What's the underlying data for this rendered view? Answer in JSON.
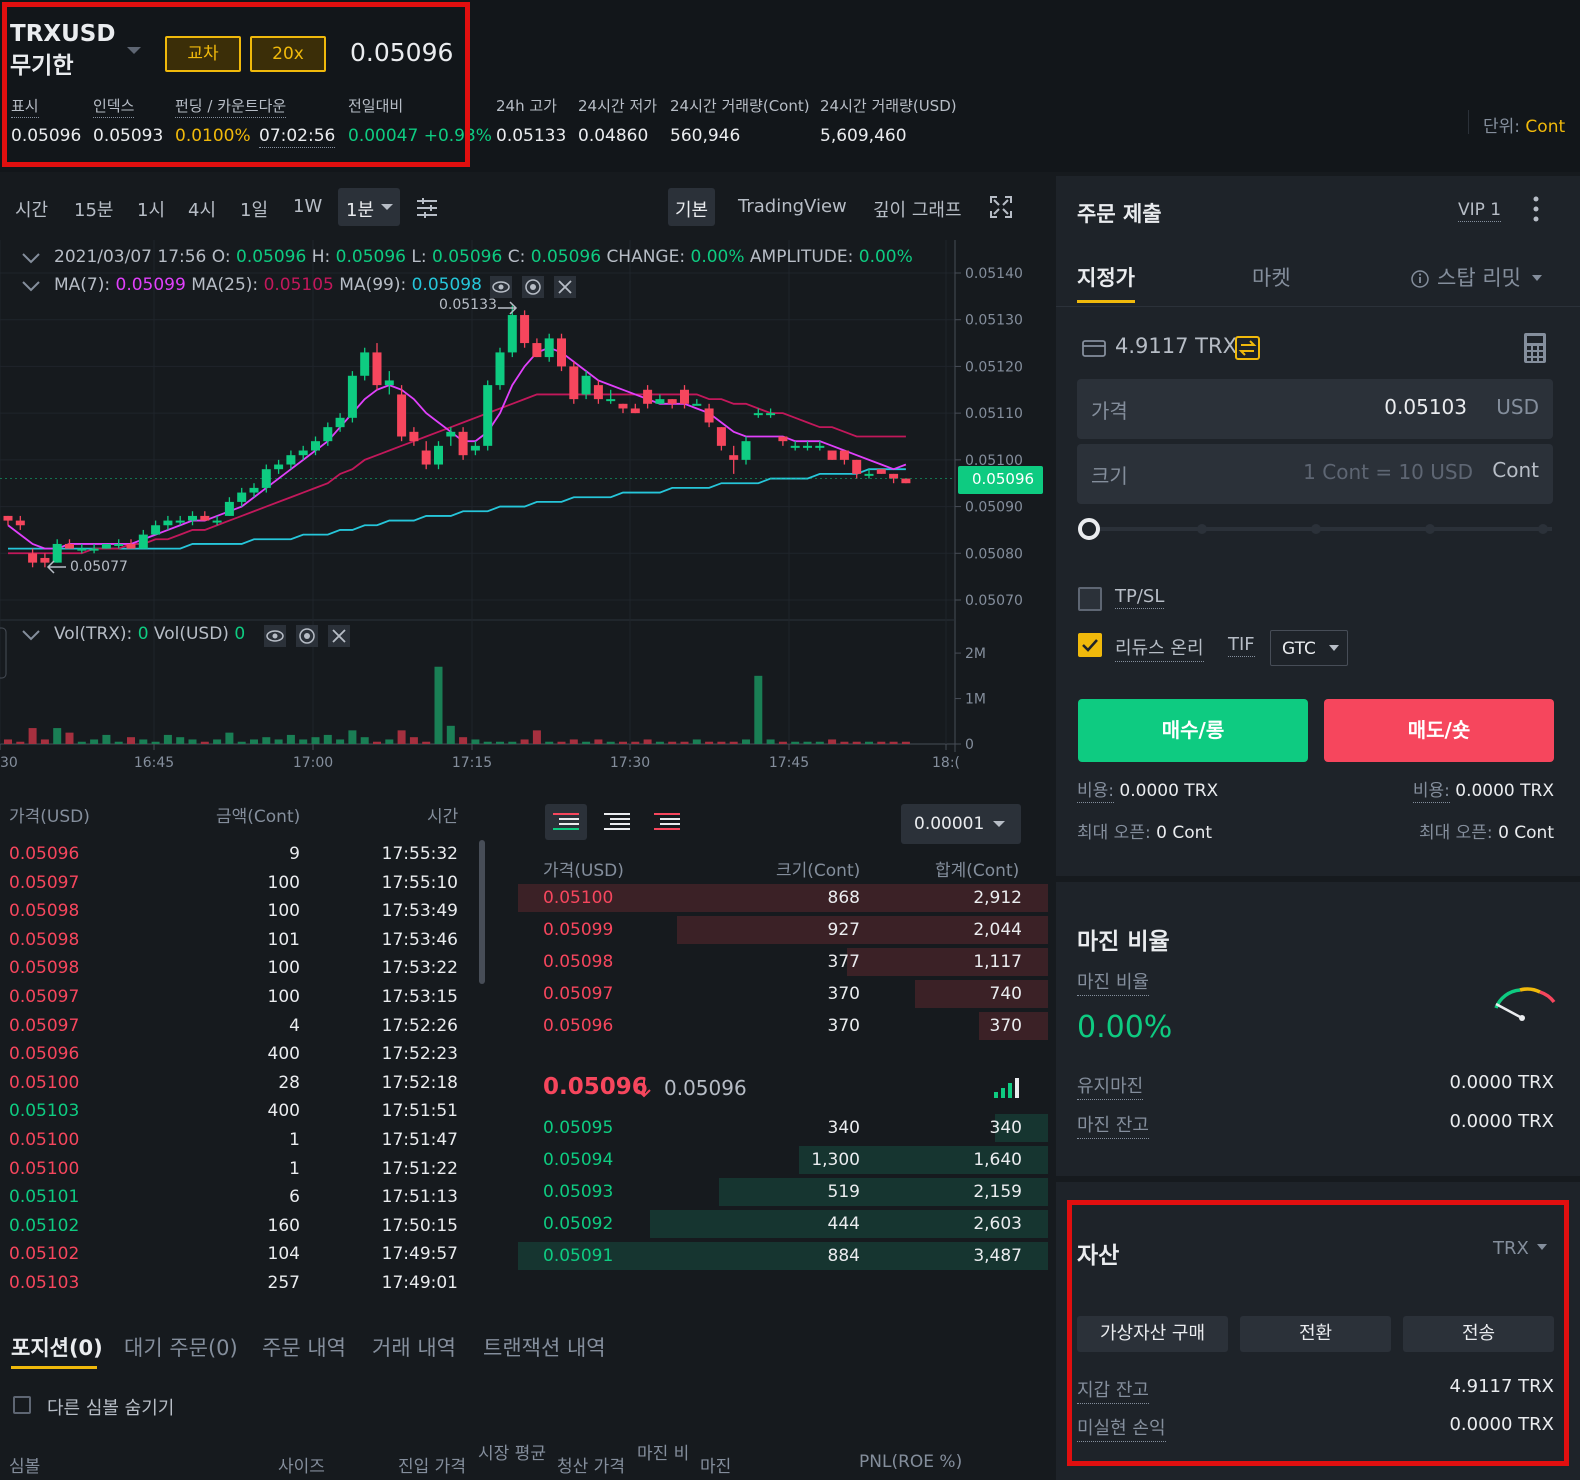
{
  "header": {
    "symbol": "TRXUSD",
    "symbol_sub": "무기한",
    "cross_label": "교차",
    "leverage_label": "20x",
    "last_price": "0.05096",
    "stats": [
      {
        "label": "표시",
        "value": "0.05096"
      },
      {
        "label": "인덱스",
        "value": "0.05093"
      },
      {
        "label": "펀딩 / 카운트다운",
        "value": "0.0100%",
        "value2": "07:02:56"
      },
      {
        "label": "전일대비",
        "value": "0.00047 +0.93%"
      },
      {
        "label": "24h 고가",
        "value": "0.05133"
      },
      {
        "label": "24시간 저가",
        "value": "0.04860"
      },
      {
        "label": "24시간 거래량(Cont)",
        "value": "560,946"
      },
      {
        "label": "24시간 거래량(USD)",
        "value": "5,609,460"
      }
    ],
    "unit_label": "단위:",
    "unit_value": "Cont"
  },
  "chart_toolbar": {
    "intervals": [
      "시간",
      "15분",
      "1시",
      "4시",
      "1일",
      "1W"
    ],
    "selected_interval": "1분",
    "views": [
      "기본",
      "TradingView",
      "깊이 그래프"
    ]
  },
  "chart_info": {
    "line1": {
      "date": "2021/03/07 17:56",
      "o": "0.05096",
      "h": "0.05096",
      "l": "0.05096",
      "c": "0.05096",
      "change": "0.00%",
      "amplitude": "0.00%"
    },
    "line2": {
      "ma7": "0.05099",
      "ma25": "0.05105",
      "ma99": "0.05098"
    },
    "vol": {
      "trx": "0",
      "usd": "0"
    },
    "high_marker": "0.05133",
    "low_marker": "0.05077",
    "current_tag": "0.05096",
    "colors": {
      "up": "#0ecb81",
      "down": "#f6465d",
      "ma7": "#e040fb",
      "ma25": "#c2185b",
      "ma99": "#26c6da"
    }
  },
  "chart_data": {
    "type": "candlestick",
    "y_ticks": [
      "0.05140",
      "0.05130",
      "0.05120",
      "0.05110",
      "0.05100",
      "0.05090",
      "0.05080",
      "0.05070"
    ],
    "ylim": [
      0.0507,
      0.0514
    ],
    "x_ticks": [
      "30",
      "16:45",
      "17:00",
      "17:15",
      "17:30",
      "17:45",
      "18:("
    ],
    "vol_ticks": [
      "2M",
      "1M",
      "0"
    ],
    "candles": [
      [
        0.05088,
        0.05088,
        0.05086,
        0.05087
      ],
      [
        0.05087,
        0.05088,
        0.05085,
        0.05086
      ],
      [
        0.0508,
        0.05081,
        0.05077,
        0.05078
      ],
      [
        0.05079,
        0.0508,
        0.05077,
        0.05078
      ],
      [
        0.05078,
        0.05083,
        0.05078,
        0.05082
      ],
      [
        0.05082,
        0.05083,
        0.05081,
        0.05081
      ],
      [
        0.05081,
        0.05082,
        0.0508,
        0.05081
      ],
      [
        0.05081,
        0.05082,
        0.0508,
        0.05081
      ],
      [
        0.05081,
        0.05082,
        0.05081,
        0.05082
      ],
      [
        0.05082,
        0.05083,
        0.05081,
        0.05082
      ],
      [
        0.05082,
        0.05083,
        0.05081,
        0.05081
      ],
      [
        0.05081,
        0.05085,
        0.05081,
        0.05084
      ],
      [
        0.05084,
        0.05087,
        0.05084,
        0.05086
      ],
      [
        0.05086,
        0.05088,
        0.05085,
        0.05087
      ],
      [
        0.05087,
        0.05088,
        0.05086,
        0.05087
      ],
      [
        0.05087,
        0.05089,
        0.05086,
        0.05088
      ],
      [
        0.05088,
        0.05089,
        0.05087,
        0.05087
      ],
      [
        0.05087,
        0.05088,
        0.05086,
        0.05087
      ],
      [
        0.05088,
        0.05092,
        0.05088,
        0.05091
      ],
      [
        0.05091,
        0.05094,
        0.0509,
        0.05093
      ],
      [
        0.05093,
        0.05095,
        0.05092,
        0.05094
      ],
      [
        0.05094,
        0.05099,
        0.05093,
        0.05098
      ],
      [
        0.05098,
        0.051,
        0.05097,
        0.05099
      ],
      [
        0.05099,
        0.05102,
        0.05098,
        0.05101
      ],
      [
        0.05101,
        0.05103,
        0.051,
        0.05102
      ],
      [
        0.05102,
        0.05105,
        0.05101,
        0.05104
      ],
      [
        0.05104,
        0.05108,
        0.05103,
        0.05107
      ],
      [
        0.05107,
        0.0511,
        0.05106,
        0.05109
      ],
      [
        0.05109,
        0.05119,
        0.05108,
        0.05118
      ],
      [
        0.05118,
        0.05124,
        0.05117,
        0.05123
      ],
      [
        0.05123,
        0.05125,
        0.05115,
        0.05116
      ],
      [
        0.05116,
        0.05119,
        0.05114,
        0.05117
      ],
      [
        0.05114,
        0.05116,
        0.05104,
        0.05105
      ],
      [
        0.05106,
        0.05107,
        0.05103,
        0.05104
      ],
      [
        0.05102,
        0.05104,
        0.05098,
        0.05099
      ],
      [
        0.05099,
        0.05104,
        0.05098,
        0.05103
      ],
      [
        0.05105,
        0.05107,
        0.05103,
        0.05106
      ],
      [
        0.05106,
        0.05107,
        0.051,
        0.05101
      ],
      [
        0.05102,
        0.05104,
        0.05101,
        0.05103
      ],
      [
        0.05103,
        0.05117,
        0.05102,
        0.05116
      ],
      [
        0.05116,
        0.05124,
        0.05115,
        0.05123
      ],
      [
        0.05123,
        0.05133,
        0.05122,
        0.05131
      ],
      [
        0.05131,
        0.05132,
        0.05124,
        0.05125
      ],
      [
        0.05125,
        0.05126,
        0.05122,
        0.05122
      ],
      [
        0.05122,
        0.05127,
        0.05121,
        0.05126
      ],
      [
        0.05126,
        0.05127,
        0.05119,
        0.0512
      ],
      [
        0.0512,
        0.05121,
        0.05112,
        0.05113
      ],
      [
        0.05114,
        0.05119,
        0.05113,
        0.05118
      ],
      [
        0.05116,
        0.05117,
        0.05112,
        0.05113
      ],
      [
        0.05113,
        0.05115,
        0.05112,
        0.05113
      ],
      [
        0.05112,
        0.05112,
        0.0511,
        0.05111
      ],
      [
        0.05111,
        0.05112,
        0.0511,
        0.0511
      ],
      [
        0.05115,
        0.05116,
        0.05111,
        0.05112
      ],
      [
        0.05112,
        0.05114,
        0.05112,
        0.05113
      ],
      [
        0.05113,
        0.05113,
        0.05111,
        0.05112
      ],
      [
        0.05115,
        0.05116,
        0.05111,
        0.05112
      ],
      [
        0.05112,
        0.05113,
        0.05112,
        0.05112
      ],
      [
        0.05111,
        0.05112,
        0.05107,
        0.05108
      ],
      [
        0.05107,
        0.05107,
        0.05102,
        0.05103
      ],
      [
        0.05101,
        0.05103,
        0.05097,
        0.051
      ],
      [
        0.051,
        0.05105,
        0.05099,
        0.05104
      ],
      [
        0.0511,
        0.05111,
        0.05109,
        0.0511
      ],
      [
        0.0511,
        0.05111,
        0.05109,
        0.0511
      ],
      [
        0.05105,
        0.05105,
        0.05103,
        0.05104
      ],
      [
        0.05103,
        0.05104,
        0.05102,
        0.05103
      ],
      [
        0.05103,
        0.05104,
        0.05102,
        0.05103
      ],
      [
        0.05103,
        0.05104,
        0.05102,
        0.05103
      ],
      [
        0.05102,
        0.05102,
        0.051,
        0.051
      ],
      [
        0.05102,
        0.05102,
        0.05099,
        0.051
      ],
      [
        0.051,
        0.051,
        0.05096,
        0.05097
      ],
      [
        0.05097,
        0.05098,
        0.05096,
        0.05097
      ],
      [
        0.05098,
        0.05098,
        0.05097,
        0.05097
      ],
      [
        0.05097,
        0.05097,
        0.05095,
        0.05096
      ],
      [
        0.05096,
        0.05096,
        0.05095,
        0.05095
      ]
    ],
    "volumes": [
      0.1,
      0.05,
      0.35,
      0.1,
      0.35,
      0.25,
      0.05,
      0.1,
      0.2,
      0.05,
      0.15,
      0.1,
      0.05,
      0.2,
      0.15,
      0.1,
      0.05,
      0.1,
      0.25,
      0.05,
      0.1,
      0.15,
      0.1,
      0.2,
      0.1,
      0.15,
      0.2,
      0.1,
      0.3,
      0.15,
      0.05,
      0.1,
      0.3,
      0.15,
      0.05,
      1.7,
      0.4,
      0.15,
      0.1,
      0.05,
      0.05,
      0.05,
      0.1,
      0.3,
      0.05,
      0.05,
      0.1,
      0.05,
      0.1,
      0.05,
      0.05,
      0.05,
      0.1,
      0.05,
      0.05,
      0.05,
      0.1,
      0.05,
      0.05,
      0.05,
      0.1,
      1.5,
      0.1,
      0.05,
      0.05,
      0.05,
      0.05,
      0.1,
      0.05,
      0.05,
      0.05,
      0.05,
      0.05,
      0.05
    ],
    "ma7": [
      0.05086,
      0.05084,
      0.05082,
      0.05081,
      0.05081,
      0.05082,
      0.05082,
      0.05082,
      0.05082,
      0.05082,
      0.05082,
      0.05083,
      0.05084,
      0.05085,
      0.05086,
      0.05087,
      0.05087,
      0.05088,
      0.05089,
      0.0509,
      0.05092,
      0.05094,
      0.05096,
      0.05098,
      0.051,
      0.05102,
      0.05104,
      0.05107,
      0.0511,
      0.05113,
      0.05115,
      0.05116,
      0.05115,
      0.05113,
      0.0511,
      0.05108,
      0.05106,
      0.05104,
      0.05104,
      0.05106,
      0.0511,
      0.05116,
      0.0512,
      0.05123,
      0.05124,
      0.05123,
      0.05121,
      0.05119,
      0.05117,
      0.05116,
      0.05115,
      0.05114,
      0.05113,
      0.05112,
      0.05112,
      0.05112,
      0.05111,
      0.0511,
      0.05108,
      0.05106,
      0.05105,
      0.05105,
      0.05105,
      0.05105,
      0.05104,
      0.05104,
      0.05104,
      0.05103,
      0.05102,
      0.05101,
      0.051,
      0.05099,
      0.05098,
      0.05099
    ],
    "ma25": [
      0.0508,
      0.0508,
      0.0508,
      0.0508,
      0.0508,
      0.0508,
      0.0508,
      0.05081,
      0.05081,
      0.05081,
      0.05082,
      0.05082,
      0.05083,
      0.05083,
      0.05084,
      0.05085,
      0.05085,
      0.05086,
      0.05087,
      0.05088,
      0.05089,
      0.0509,
      0.05091,
      0.05092,
      0.05093,
      0.05094,
      0.05095,
      0.05097,
      0.05098,
      0.051,
      0.05101,
      0.05102,
      0.05103,
      0.05104,
      0.05105,
      0.05106,
      0.05107,
      0.05108,
      0.05109,
      0.0511,
      0.05111,
      0.05112,
      0.05113,
      0.05114,
      0.05114,
      0.05114,
      0.05114,
      0.05114,
      0.05114,
      0.05114,
      0.05114,
      0.05114,
      0.05114,
      0.05114,
      0.05114,
      0.05114,
      0.05114,
      0.05113,
      0.05113,
      0.05112,
      0.05112,
      0.05111,
      0.0511,
      0.0511,
      0.05109,
      0.05108,
      0.05107,
      0.05107,
      0.05106,
      0.05105,
      0.05105,
      0.05105,
      0.05105,
      0.05105
    ],
    "ma99": [
      0.05081,
      0.05081,
      0.05081,
      0.05081,
      0.05081,
      0.05081,
      0.05081,
      0.05081,
      0.05081,
      0.05081,
      0.05081,
      0.05081,
      0.05081,
      0.05081,
      0.05081,
      0.05082,
      0.05082,
      0.05082,
      0.05082,
      0.05082,
      0.05083,
      0.05083,
      0.05083,
      0.05083,
      0.05084,
      0.05084,
      0.05084,
      0.05085,
      0.05085,
      0.05086,
      0.05086,
      0.05087,
      0.05087,
      0.05087,
      0.05088,
      0.05088,
      0.05088,
      0.05089,
      0.05089,
      0.05089,
      0.0509,
      0.0509,
      0.0509,
      0.05091,
      0.05091,
      0.05091,
      0.05092,
      0.05092,
      0.05092,
      0.05092,
      0.05093,
      0.05093,
      0.05093,
      0.05093,
      0.05094,
      0.05094,
      0.05094,
      0.05094,
      0.05095,
      0.05095,
      0.05095,
      0.05095,
      0.05096,
      0.05096,
      0.05096,
      0.05096,
      0.05097,
      0.05097,
      0.05097,
      0.05097,
      0.05098,
      0.05098,
      0.05098,
      0.05098
    ]
  },
  "trades": {
    "headers": [
      "가격(USD)",
      "금액(Cont)",
      "시간"
    ],
    "rows": [
      {
        "price": "0.05096",
        "side": "dn",
        "amount": "9",
        "time": "17:55:32"
      },
      {
        "price": "0.05097",
        "side": "dn",
        "amount": "100",
        "time": "17:55:10"
      },
      {
        "price": "0.05098",
        "side": "dn",
        "amount": "100",
        "time": "17:53:49"
      },
      {
        "price": "0.05098",
        "side": "dn",
        "amount": "101",
        "time": "17:53:46"
      },
      {
        "price": "0.05098",
        "side": "dn",
        "amount": "100",
        "time": "17:53:22"
      },
      {
        "price": "0.05097",
        "side": "dn",
        "amount": "100",
        "time": "17:53:15"
      },
      {
        "price": "0.05097",
        "side": "dn",
        "amount": "4",
        "time": "17:52:26"
      },
      {
        "price": "0.05096",
        "side": "dn",
        "amount": "400",
        "time": "17:52:23"
      },
      {
        "price": "0.05100",
        "side": "dn",
        "amount": "28",
        "time": "17:52:18"
      },
      {
        "price": "0.05103",
        "side": "up",
        "amount": "400",
        "time": "17:51:51"
      },
      {
        "price": "0.05100",
        "side": "dn",
        "amount": "1",
        "time": "17:51:47"
      },
      {
        "price": "0.05100",
        "side": "dn",
        "amount": "1",
        "time": "17:51:22"
      },
      {
        "price": "0.05101",
        "side": "up",
        "amount": "6",
        "time": "17:51:13"
      },
      {
        "price": "0.05102",
        "side": "up",
        "amount": "160",
        "time": "17:50:15"
      },
      {
        "price": "0.05102",
        "side": "dn",
        "amount": "104",
        "time": "17:49:57"
      },
      {
        "price": "0.05103",
        "side": "dn",
        "amount": "257",
        "time": "17:49:01"
      }
    ]
  },
  "orderbook": {
    "precision": "0.00001",
    "headers": [
      "가격(USD)",
      "크기(Cont)",
      "합계(Cont)"
    ],
    "asks": [
      {
        "price": "0.05100",
        "size": "868",
        "total": "2,912",
        "depth": 1.0
      },
      {
        "price": "0.05099",
        "size": "927",
        "total": "2,044",
        "depth": 0.7
      },
      {
        "price": "0.05098",
        "size": "377",
        "total": "1,117",
        "depth": 0.38
      },
      {
        "price": "0.05097",
        "size": "370",
        "total": "740",
        "depth": 0.25
      },
      {
        "price": "0.05096",
        "size": "370",
        "total": "370",
        "depth": 0.13
      }
    ],
    "mid_price": "0.05096",
    "mid_mark": "0.05096",
    "bids": [
      {
        "price": "0.05095",
        "size": "340",
        "total": "340",
        "depth": 0.1
      },
      {
        "price": "0.05094",
        "size": "1,300",
        "total": "1,640",
        "depth": 0.47
      },
      {
        "price": "0.05093",
        "size": "519",
        "total": "2,159",
        "depth": 0.62
      },
      {
        "price": "0.05092",
        "size": "444",
        "total": "2,603",
        "depth": 0.75
      },
      {
        "price": "0.05091",
        "size": "884",
        "total": "3,487",
        "depth": 1.0
      }
    ]
  },
  "bottom": {
    "tabs": [
      "포지션(0)",
      "대기 주문(0)",
      "주문 내역",
      "거래 내역",
      "트랜잭션 내역"
    ],
    "hide_label": "다른 심볼 숨기기",
    "columns": [
      "심볼",
      "사이즈",
      "진입 가격",
      "시장 평균",
      "청산 가격",
      "마진 비",
      "마진",
      "PNL(ROE %)"
    ]
  },
  "order": {
    "title": "주문 제출",
    "vip": "VIP 1",
    "tabs": [
      "지정가",
      "마켓",
      "스탑 리밋"
    ],
    "balance": "4.9117 TRX",
    "price_label": "가격",
    "price_value": "0.05103",
    "price_unit": "USD",
    "size_label": "크기",
    "size_placeholder": "1 Cont = 10 USD",
    "size_unit": "Cont",
    "tpsl_label": "TP/SL",
    "reduce_label": "리듀스 온리",
    "tif_label": "TIF",
    "tif_value": "GTC",
    "buy_label": "매수/롱",
    "sell_label": "매도/숏",
    "fee_label": "비용:",
    "fee_buy": "0.0000 TRX",
    "fee_sell": "0.0000 TRX",
    "max_label": "최대 오픈:",
    "max_buy": "0 Cont",
    "max_sell": "0 Cont"
  },
  "margin": {
    "title": "마진 비율",
    "ratio_label": "마진 비율",
    "ratio_value": "0.00%",
    "maint_label": "유지마진",
    "maint_value": "0.0000 TRX",
    "balance_label": "마진 잔고",
    "balance_value": "0.0000 TRX"
  },
  "assets": {
    "title": "자산",
    "currency": "TRX",
    "buttons": [
      "가상자산 구매",
      "전환",
      "전송"
    ],
    "wallet_label": "지갑 잔고",
    "wallet_value": "4.9117 TRX",
    "pnl_label": "미실현 손익",
    "pnl_value": "0.0000 TRX"
  }
}
